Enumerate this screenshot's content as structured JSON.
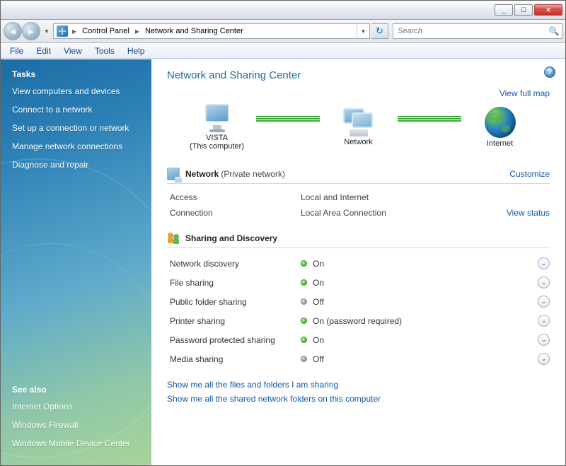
{
  "titlebar": {
    "min": "_",
    "max": "☐",
    "close": "✕"
  },
  "breadcrumb": {
    "item1": "Control Panel",
    "item2": "Network and Sharing Center"
  },
  "search": {
    "placeholder": "Search"
  },
  "menu": {
    "file": "File",
    "edit": "Edit",
    "view": "View",
    "tools": "Tools",
    "help": "Help"
  },
  "sidebar": {
    "tasks_head": "Tasks",
    "tasks": [
      "View computers and devices",
      "Connect to a network",
      "Set up a connection or network",
      "Manage network connections",
      "Diagnose and repair"
    ],
    "see_also_head": "See also",
    "see_also": [
      "Internet Options",
      "Windows Firewall",
      "Windows Mobile Device Center"
    ]
  },
  "page_title": "Network and Sharing Center",
  "view_full_map": "View full map",
  "map": {
    "node1": "VISTA",
    "node1_sub": "(This computer)",
    "node2": "Network",
    "node3": "Internet"
  },
  "network_section": {
    "title": "Network",
    "meta": "(Private network)",
    "customize": "Customize",
    "rows": [
      {
        "label": "Access",
        "value": "Local and Internet",
        "link": ""
      },
      {
        "label": "Connection",
        "value": "Local Area Connection",
        "link": "View status"
      }
    ]
  },
  "sharing_section": {
    "title": "Sharing and Discovery",
    "items": [
      {
        "label": "Network discovery",
        "state": "on",
        "value": "On"
      },
      {
        "label": "File sharing",
        "state": "on",
        "value": "On"
      },
      {
        "label": "Public folder sharing",
        "state": "off",
        "value": "Off"
      },
      {
        "label": "Printer sharing",
        "state": "on",
        "value": "On (password required)"
      },
      {
        "label": "Password protected sharing",
        "state": "on",
        "value": "On"
      },
      {
        "label": "Media sharing",
        "state": "off",
        "value": "Off"
      }
    ]
  },
  "footer": {
    "link1": "Show me all the files and folders I am sharing",
    "link2": "Show me all the shared network folders on this computer"
  }
}
